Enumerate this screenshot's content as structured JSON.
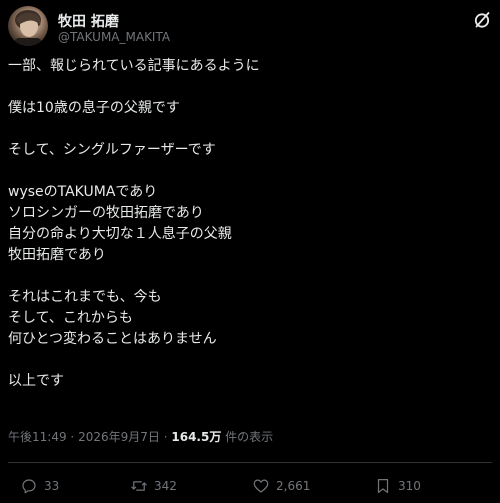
{
  "author": {
    "display_name": "牧田 拓磨",
    "handle": "@TAKUMA_MAKITA"
  },
  "post": {
    "lines": [
      "一部、報じられている記事にあるように",
      "",
      "僕は10歳の息子の父親です",
      "",
      "そして、シングルファーザーです",
      "",
      "wyseのTAKUMAであり",
      "ソロシンガーの牧田拓磨であり",
      "自分の命より大切な１人息子の父親",
      "牧田拓磨であり",
      "",
      "それはこれまでも、今も",
      "そして、これからも",
      "何ひとつ変わることはありません",
      "",
      "以上です"
    ]
  },
  "meta": {
    "time": "午後11:49",
    "separator": "·",
    "date": "2026年9月7日",
    "views_count": "164.5万",
    "views_label": "件の表示"
  },
  "actions": {
    "replies": "33",
    "reposts": "342",
    "likes": "2,661",
    "bookmarks": "310"
  },
  "icons": {
    "top_right": "grok-icon",
    "reply": "reply-icon",
    "repost": "repost-icon",
    "like": "heart-icon",
    "bookmark": "bookmark-icon"
  },
  "colors": {
    "background": "#000000",
    "text": "#e7e9ea",
    "muted": "#71767b",
    "divider": "#2f3336"
  }
}
